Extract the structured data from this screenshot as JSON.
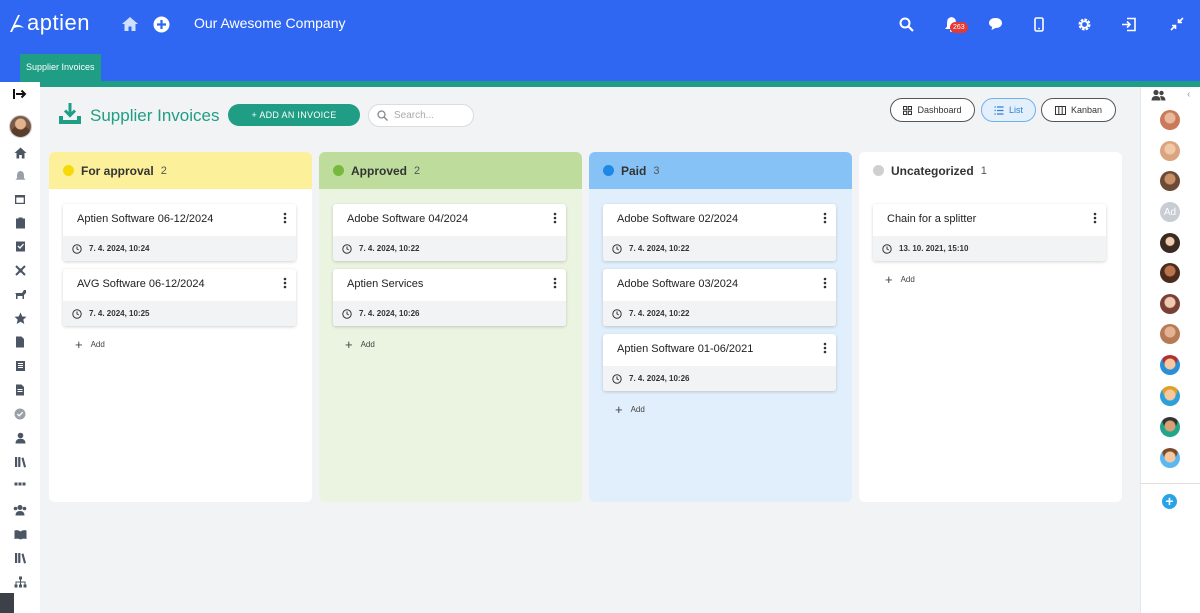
{
  "app": {
    "logo_text": "aptien",
    "company_name": "Our Awesome Company",
    "notification_count": "263",
    "brand_color": "#2f66f2",
    "accent_color": "#1f9e85"
  },
  "tab": {
    "label": "Supplier Invoices"
  },
  "page": {
    "title": "Supplier Invoices",
    "add_button": "+ ADD AN INVOICE",
    "search_placeholder": "Search...",
    "views": [
      {
        "label": "Dashboard",
        "icon": "grid-icon",
        "active": false
      },
      {
        "label": "List",
        "icon": "list-icon",
        "active": true
      },
      {
        "label": "Kanban",
        "icon": "kanban-icon",
        "active": false
      }
    ]
  },
  "columns": [
    {
      "title": "For approval",
      "count": "2",
      "header_color": "#fdf09a",
      "dot_color": "#f5d90a",
      "body_color": "#ffffff",
      "cards": [
        {
          "title": "Aptien Software 06-12/2024",
          "date": "7. 4. 2024, 10:24"
        },
        {
          "title": "AVG Software 06-12/2024",
          "date": "7. 4. 2024, 10:25"
        }
      ],
      "add_label": "Add"
    },
    {
      "title": "Approved",
      "count": "2",
      "header_color": "#bedd9c",
      "dot_color": "#78b83f",
      "body_color": "#eaf4e0",
      "cards": [
        {
          "title": "Adobe Software 04/2024",
          "date": "7. 4. 2024, 10:22"
        },
        {
          "title": "Aptien Services",
          "date": "7. 4. 2024, 10:26"
        }
      ],
      "add_label": "Add"
    },
    {
      "title": "Paid",
      "count": "3",
      "header_color": "#86c2f5",
      "dot_color": "#1e88e5",
      "body_color": "#e1effc",
      "cards": [
        {
          "title": "Adobe Software 02/2024",
          "date": "7. 4. 2024, 10:22"
        },
        {
          "title": "Adobe Software 03/2024",
          "date": "7. 4. 2024, 10:22"
        },
        {
          "title": "Aptien Software 01-06/2021",
          "date": "7. 4. 2024, 10:26"
        }
      ],
      "add_label": "Add"
    },
    {
      "title": "Uncategorized",
      "count": "1",
      "header_color": "#ffffff",
      "dot_color": "#cfcfcf",
      "body_color": "#ffffff",
      "cards": [
        {
          "title": "Chain for a splitter",
          "date": "13. 10. 2021, 15:10"
        }
      ],
      "add_label": "Add"
    }
  ],
  "right_sidebar": {
    "avatar_placeholder": "Ad"
  }
}
